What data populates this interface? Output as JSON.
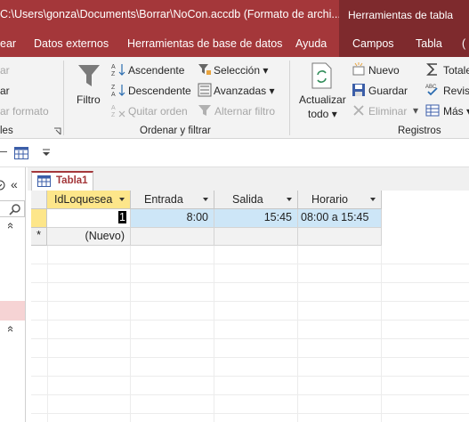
{
  "window": {
    "title": "C:\\Users\\gonza\\Documents\\Borrar\\NoCon.accdb (Formato de archi...",
    "context_group": "Herramientas de tabla"
  },
  "tabs": [
    "ear",
    "Datos externos",
    "Herramientas de base de datos",
    "Ayuda"
  ],
  "context_tabs": [
    "Campos",
    "Tabla",
    "("
  ],
  "ribbon": {
    "clipboard_partial": {
      "item1": "ar",
      "item2": "ar",
      "item3": "ar formato",
      "group": "les"
    },
    "sort_filter": {
      "filter_label": "Filtro",
      "ascending": "Ascendente",
      "descending": "Descendente",
      "remove_sort": "Quitar orden",
      "selection": "Selección",
      "advanced": "Avanzadas",
      "toggle_filter": "Alternar filtro",
      "group": "Ordenar y filtrar"
    },
    "records": {
      "refresh_line1": "Actualizar",
      "refresh_line2": "todo",
      "new": "Nuevo",
      "save": "Guardar",
      "delete": "Eliminar",
      "totals": "Totale",
      "spelling": "Revisi",
      "more": "Más",
      "group": "Registros"
    }
  },
  "doc_tab": {
    "label": "Tabla1"
  },
  "table": {
    "columns": [
      "IdLoquesea",
      "Entrada",
      "Salida",
      "Horario"
    ],
    "rows": [
      {
        "id": "1",
        "entrada": "8:00",
        "salida": "15:45",
        "horario": "08:00 a 15:45"
      }
    ],
    "new_row_label": "(Nuevo)",
    "new_row_marker": "*"
  },
  "nav": {
    "collapse": "«",
    "chevron1": "«",
    "chevron2": "«"
  },
  "colors": {
    "brand": "#a4373a",
    "context": "#7e2a2d",
    "header_selected": "#fde68a",
    "row_selected": "#cde6f7"
  }
}
